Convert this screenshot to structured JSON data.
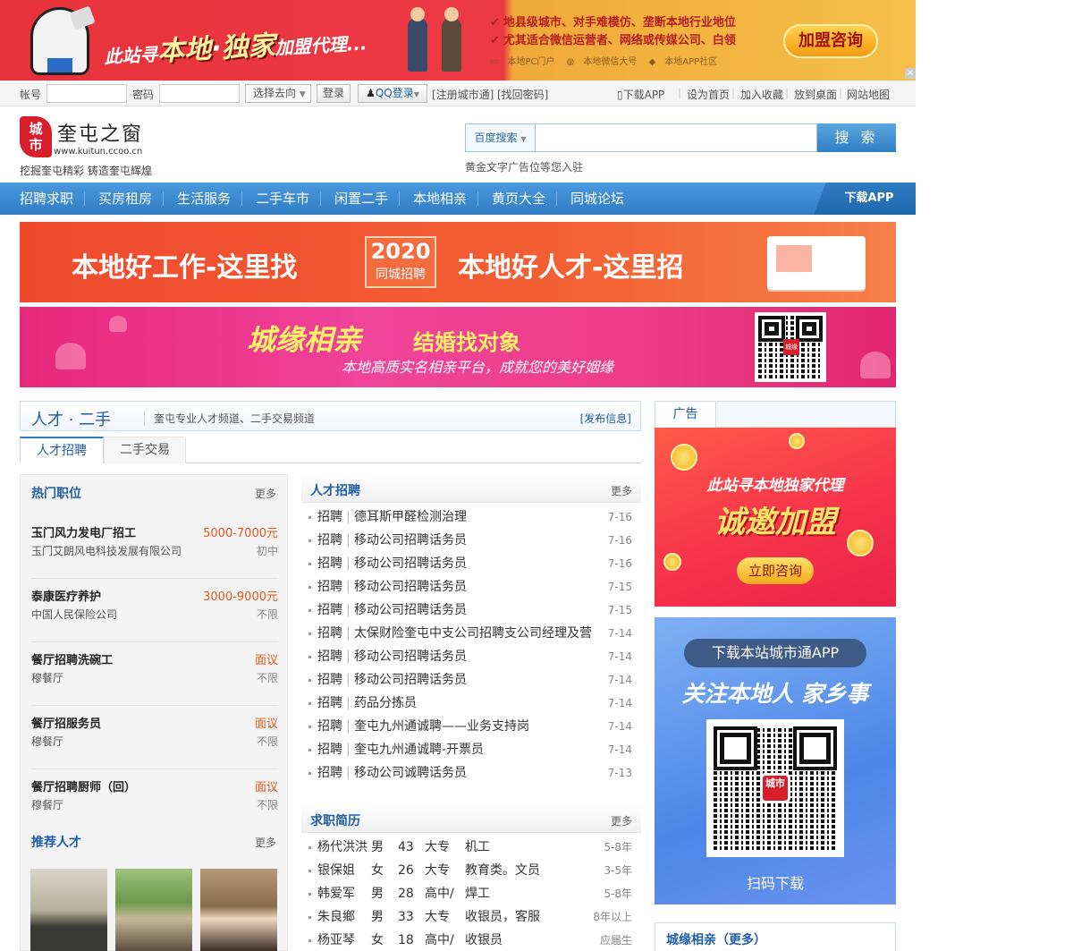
{
  "top_banner": {
    "slogan_prefix": "此站寻",
    "slogan_local": "本地",
    "slogan_dot": "·",
    "slogan_exclusive": "独家",
    "slogan_suffix": "加盟代理...",
    "features": [
      "地县级城市、对手难模仿、垄断本地行业地位",
      "尤其适合微信运营者、网络或传媒公司、白领"
    ],
    "sub_items": [
      "本地PC门户",
      "本地微信大号",
      "本地APP社区"
    ],
    "join_button": "加盟咨询",
    "close": "×"
  },
  "login_bar": {
    "account_label": "帐号",
    "password_label": "密码",
    "go_select": "选择去向",
    "login_button": "登录",
    "qq_login": "QQ登录",
    "register": "[注册城市通]",
    "find_password": "[找回密码]",
    "right_links": [
      "下载APP",
      "设为首页",
      "加入收藏",
      "放到桌面",
      "网站地图"
    ]
  },
  "header": {
    "logo_badge": "城市",
    "site_name": "奎屯之窗",
    "site_url": "www.kuitun.ccoo.cn",
    "slogan": "挖掘奎屯精彩 铸造奎屯辉煌",
    "search_engine": "百度搜索",
    "search_button": "搜 索",
    "ad_hint": "黄金文字广告位等您入驻"
  },
  "nav": {
    "items": [
      "招聘求职",
      "买房租房",
      "生活服务",
      "二手车市",
      "闲置二手",
      "本地相亲",
      "黄页大全",
      "同城论坛"
    ],
    "app": "下载APP"
  },
  "promo1": {
    "left": "本地好工作-这里找",
    "year": "2020",
    "year_sub": "同城招聘",
    "right": "本地好人才-这里招"
  },
  "promo2": {
    "title": "城缘相亲",
    "subtitle": "结婚找对象",
    "desc": "本地高质实名相亲平台，成就您的美好姻缘",
    "qr_logo": "城缘"
  },
  "section": {
    "title": "人才 · 二手",
    "desc": "奎屯专业人才频道、二手交易频道",
    "post": "[发布信息]",
    "tabs": [
      "人才招聘",
      "二手交易"
    ]
  },
  "hot_jobs": {
    "title": "热门职位",
    "more": "更多",
    "items": [
      {
        "title": "玉门风力发电厂招工",
        "salary": "5000-7000元",
        "company": "玉门艾朗风电科技发展有限公司",
        "edu": "初中"
      },
      {
        "title": "泰康医疗养护",
        "salary": "3000-9000元",
        "company": "中国人民保险公司",
        "edu": "不限"
      },
      {
        "title": "餐厅招聘洗碗工",
        "salary": "面议",
        "company": "穆餐厅",
        "edu": "不限"
      },
      {
        "title": "餐厅招服务员",
        "salary": "面议",
        "company": "穆餐厅",
        "edu": "不限"
      },
      {
        "title": "餐厅招聘厨师（回）",
        "salary": "面议",
        "company": "穆餐厅",
        "edu": "不限"
      }
    ],
    "talent_title": "推荐人才",
    "talent_more": "更多"
  },
  "recruit": {
    "title": "人才招聘",
    "more": "更多",
    "items": [
      {
        "cat": "招聘",
        "title": "德耳斯甲醛检测治理",
        "date": "7-16"
      },
      {
        "cat": "招聘",
        "title": "移动公司招聘话务员",
        "date": "7-16"
      },
      {
        "cat": "招聘",
        "title": "移动公司招聘话务员",
        "date": "7-16"
      },
      {
        "cat": "招聘",
        "title": "移动公司招聘话务员",
        "date": "7-15"
      },
      {
        "cat": "招聘",
        "title": "移动公司招聘话务员",
        "date": "7-15"
      },
      {
        "cat": "招聘",
        "title": "太保财险奎屯中支公司招聘支公司经理及营",
        "date": "7-14"
      },
      {
        "cat": "招聘",
        "title": "移动公司招聘话务员",
        "date": "7-14"
      },
      {
        "cat": "招聘",
        "title": "移动公司招聘话务员",
        "date": "7-14"
      },
      {
        "cat": "招聘",
        "title": "药品分拣员",
        "date": "7-14"
      },
      {
        "cat": "招聘",
        "title": "奎屯九州通诚聘——业务支持岗",
        "date": "7-14"
      },
      {
        "cat": "招聘",
        "title": "奎屯九州通诚聘-开票员",
        "date": "7-14"
      },
      {
        "cat": "招聘",
        "title": "移动公司诚聘话务员",
        "date": "7-13"
      }
    ]
  },
  "resumes": {
    "title": "求职简历",
    "more": "更多",
    "items": [
      {
        "name": "杨代洪洪",
        "sex": "男",
        "age": "43",
        "edu": "大专",
        "job": "机工",
        "exp": "5-8年"
      },
      {
        "name": "银保姐",
        "sex": "女",
        "age": "26",
        "edu": "大专",
        "job": "教育类。文员",
        "exp": "3-5年"
      },
      {
        "name": "韩爱军",
        "sex": "男",
        "age": "28",
        "edu": "高中/",
        "job": "焊工",
        "exp": "5-8年"
      },
      {
        "name": "朱良鄉",
        "sex": "男",
        "age": "33",
        "edu": "大专",
        "job": "收银员，客服",
        "exp": "8年以上"
      },
      {
        "name": "杨亚琴",
        "sex": "女",
        "age": "18",
        "edu": "高中/",
        "job": "收银员",
        "exp": "应届生"
      }
    ]
  },
  "right": {
    "ad_tab": "广告",
    "franchise_line1": "此站寻本地独家代理",
    "franchise_line2": "诚邀加盟",
    "franchise_button": "立即咨询",
    "app_pill": "下载本站城市通APP",
    "app_slogan": "关注本地人 家乡事",
    "app_qr_logo": "城市",
    "app_scan": "扫码下载",
    "dating_title": "城缘相亲（更多）"
  }
}
